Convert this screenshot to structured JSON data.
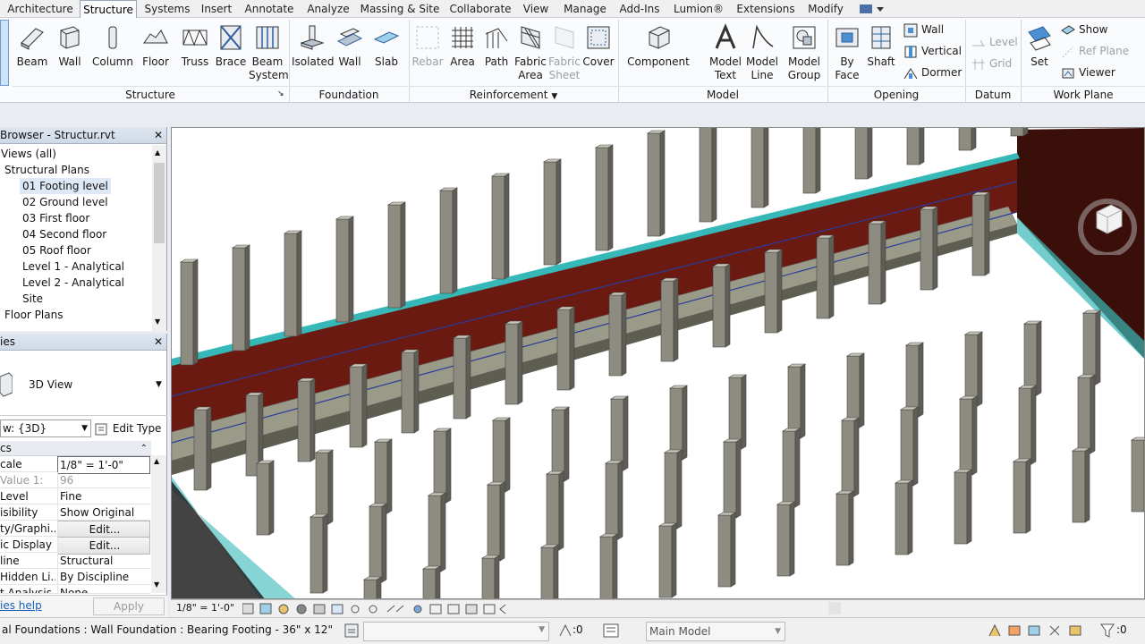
{
  "menu": {
    "tabs": [
      "Architecture",
      "Structure",
      "Systems",
      "Insert",
      "Annotate",
      "Analyze",
      "Massing & Site",
      "Collaborate",
      "View",
      "Manage",
      "Add-Ins",
      "Lumion®",
      "Extensions",
      "Modify"
    ],
    "active": "Structure"
  },
  "ribbon": {
    "structure": {
      "beam": "Beam",
      "wall": "Wall",
      "column": "Column",
      "floor": "Floor",
      "truss": "Truss",
      "brace": "Brace",
      "beam_system_1": "Beam",
      "beam_system_2": "System",
      "panel": "Structure"
    },
    "foundation": {
      "isolated": "Isolated",
      "wall": "Wall",
      "slab": "Slab",
      "panel": "Foundation"
    },
    "reinforcement": {
      "rebar": "Rebar",
      "area": "Area",
      "path": "Path",
      "fabric_area_1": "Fabric",
      "fabric_area_2": "Area",
      "fabric_sheet_1": "Fabric",
      "fabric_sheet_2": "Sheet",
      "cover": "Cover",
      "panel": "Reinforcement"
    },
    "model": {
      "component": "Component",
      "model_text_1": "Model",
      "model_text_2": "Text",
      "model_line_1": "Model",
      "model_line_2": "Line",
      "model_group_1": "Model",
      "model_group_2": "Group",
      "panel": "Model"
    },
    "opening": {
      "by_face_1": "By",
      "by_face_2": "Face",
      "shaft": "Shaft",
      "wall": "Wall",
      "vertical": "Vertical",
      "dormer": "Dormer",
      "panel": "Opening"
    },
    "datum": {
      "level": "Level",
      "grid": "Grid",
      "panel": "Datum"
    },
    "work_plane": {
      "set": "Set",
      "show": "Show",
      "ref_plane": "Ref  Plane",
      "viewer": "Viewer",
      "panel": "Work Plane"
    }
  },
  "browser": {
    "title": "Browser - Structur.rvt",
    "views_all": "Views (all)",
    "structural_plans": "Structural Plans",
    "items": [
      "01 Footing level",
      "02 Ground level",
      "03 First floor",
      "04 Second floor",
      "05 Roof floor",
      "Level 1 - Analytical",
      "Level 2 - Analytical",
      "Site"
    ],
    "selected": "01 Footing level",
    "floor_plans": "Floor Plans"
  },
  "properties": {
    "title": "ies",
    "type_name": "3D View",
    "view_selector": "w: {3D}",
    "edit_type": "Edit Type",
    "section": "cs",
    "rows": [
      {
        "k": "cale",
        "v": "1/8\" = 1'-0\""
      },
      {
        "k": "Value    1:",
        "v": "96"
      },
      {
        "k": "Level",
        "v": "Fine"
      },
      {
        "k": "isibility",
        "v": "Show Original"
      },
      {
        "k": "ty/Graphi...",
        "v": "Edit..."
      },
      {
        "k": "ic Display ...",
        "v": "Edit..."
      },
      {
        "k": "line",
        "v": "Structural"
      },
      {
        "k": "Hidden Li...",
        "v": "By Discipline"
      },
      {
        "k": "t Analysis",
        "v": "None"
      }
    ],
    "help_link": "ies help",
    "apply": "Apply"
  },
  "view_controls": {
    "scale": "1/8\" = 1'-0\""
  },
  "status": {
    "message": "al Foundations : Wall Foundation : Bearing Footing - 36\" x 12\"",
    "filter_count": ":0",
    "workset": "Main Model",
    "selection_count": ":0"
  },
  "colors": {
    "wall_red": "#6b1a12",
    "footing": "#9a9a88",
    "column": "#8e8c80",
    "accent_cyan": "#37b8b8",
    "ribbon_bg": "#fafbfd"
  }
}
